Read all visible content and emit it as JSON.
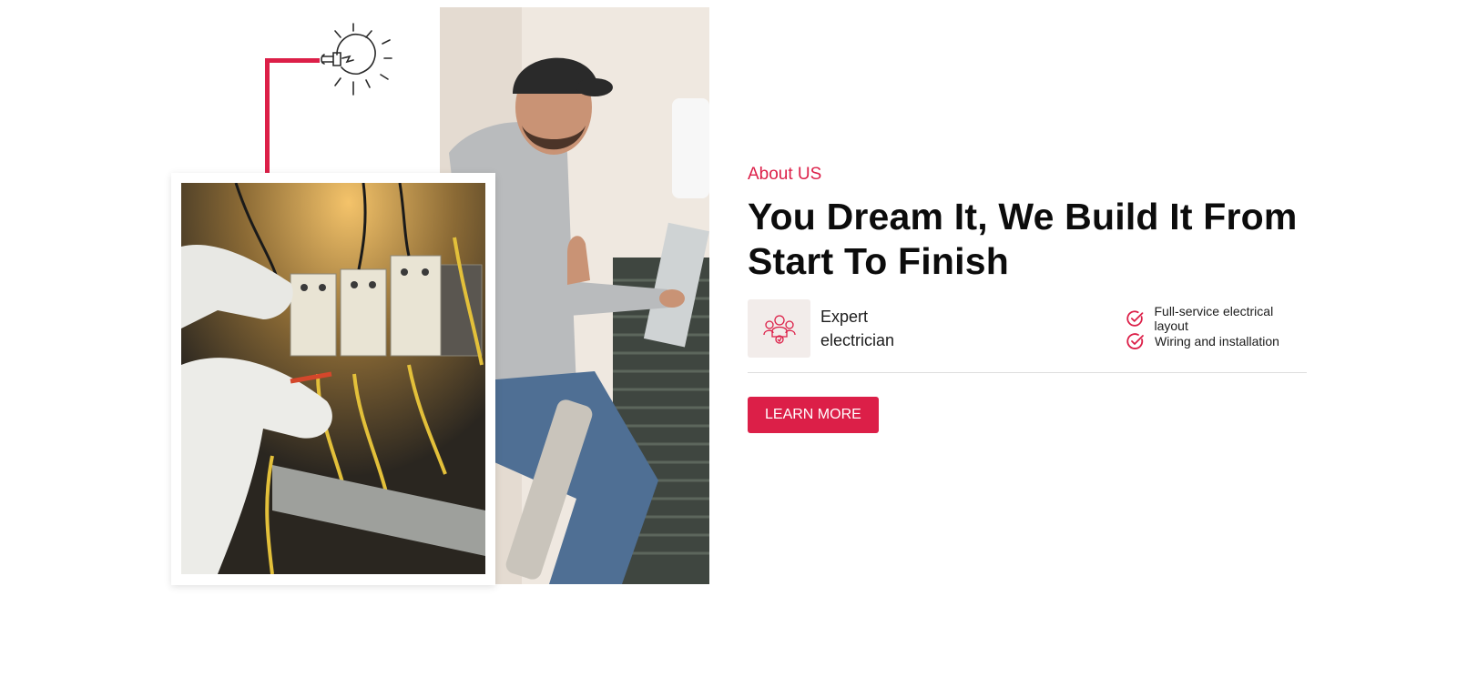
{
  "about": {
    "eyebrow": "About US",
    "headline": "You Dream It, We Build It From Start To Finish"
  },
  "feature": {
    "icon": "team-icon",
    "label_line1": "Expert",
    "label_line2": "electrician"
  },
  "checklist": [
    {
      "icon": "check-circle-icon",
      "text": "Full-service electrical layout"
    },
    {
      "icon": "check-circle-icon",
      "text": "Wiring and installation"
    }
  ],
  "cta": {
    "label": "LEARN MORE"
  },
  "colors": {
    "accent": "#dc1f48",
    "icon_bg": "#f2ecea",
    "text": "#0c0c0c"
  }
}
